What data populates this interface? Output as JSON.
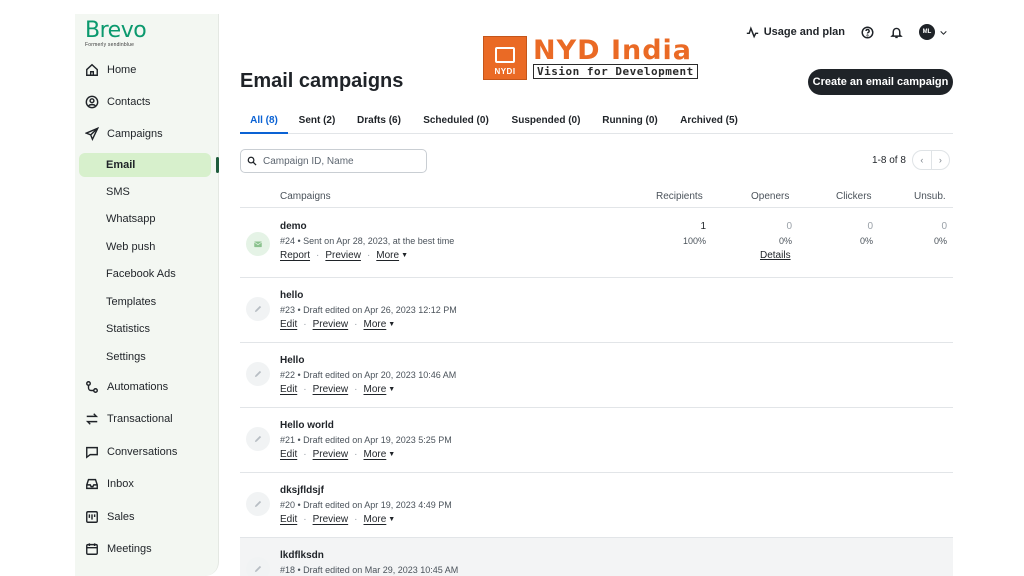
{
  "brand": {
    "name": "Brevo",
    "formerly": "Formerly sendinblue"
  },
  "watermark": {
    "badge": "NYDI",
    "title": "NYD India",
    "tagline": "Vision for Development"
  },
  "sidebar": {
    "items": [
      {
        "label": "Home",
        "icon": "home-icon"
      },
      {
        "label": "Contacts",
        "icon": "contacts-icon"
      },
      {
        "label": "Campaigns",
        "icon": "send-icon"
      }
    ],
    "campaign_subitems": [
      "Email",
      "SMS",
      "Whatsapp",
      "Web push",
      "Facebook Ads",
      "Templates",
      "Statistics",
      "Settings"
    ],
    "active_subitem": "Email",
    "lower_items": [
      {
        "label": "Automations",
        "icon": "automation-icon"
      },
      {
        "label": "Transactional",
        "icon": "transactional-icon"
      },
      {
        "label": "Conversations",
        "icon": "chat-icon"
      },
      {
        "label": "Inbox",
        "icon": "inbox-icon"
      },
      {
        "label": "Sales",
        "icon": "sales-icon"
      },
      {
        "label": "Meetings",
        "icon": "calendar-icon"
      }
    ]
  },
  "topbar": {
    "usage_label": "Usage and plan",
    "avatar_initials": "ML"
  },
  "page": {
    "title": "Email campaigns",
    "create_button": "Create an email campaign"
  },
  "tabs": [
    {
      "label": "All (8)",
      "active": true
    },
    {
      "label": "Sent (2)"
    },
    {
      "label": "Drafts (6)"
    },
    {
      "label": "Scheduled (0)"
    },
    {
      "label": "Suspended (0)"
    },
    {
      "label": "Running (0)"
    },
    {
      "label": "Archived (5)"
    }
  ],
  "search": {
    "placeholder": "Campaign ID, Name",
    "value": ""
  },
  "pagination": {
    "label": "1-8 of 8"
  },
  "table": {
    "headers": {
      "campaigns": "Campaigns",
      "recipients": "Recipients",
      "openers": "Openers",
      "clickers": "Clickers",
      "unsub": "Unsub."
    },
    "rows": [
      {
        "name": "demo",
        "meta": "#24 • Sent on Apr 28, 2023, at the best time",
        "status": "sent",
        "actions": [
          "Report",
          "Preview",
          "More"
        ],
        "recipients": "1",
        "recipients_pct": "100%",
        "openers": "0",
        "openers_pct": "0%",
        "clickers": "0",
        "clickers_pct": "0%",
        "unsub": "0",
        "unsub_pct": "0%",
        "details": "Details"
      },
      {
        "name": "hello",
        "meta": "#23 • Draft edited on Apr 26, 2023 12:12 PM",
        "status": "draft",
        "actions": [
          "Edit",
          "Preview",
          "More"
        ]
      },
      {
        "name": "Hello",
        "meta": "#22 • Draft edited on Apr 20, 2023 10:46 AM",
        "status": "draft",
        "actions": [
          "Edit",
          "Preview",
          "More"
        ]
      },
      {
        "name": "Hello world",
        "meta": "#21 • Draft edited on Apr 19, 2023 5:25 PM",
        "status": "draft",
        "actions": [
          "Edit",
          "Preview",
          "More"
        ]
      },
      {
        "name": "dksjfldsjf",
        "meta": "#20 • Draft edited on Apr 19, 2023 4:49 PM",
        "status": "draft",
        "actions": [
          "Edit",
          "Preview",
          "More"
        ]
      },
      {
        "name": "lkdflksdn",
        "meta": "#18 • Draft edited on Mar 29, 2023 10:45 AM",
        "status": "draft",
        "actions": []
      }
    ]
  },
  "colors": {
    "brand_green": "#0b996e",
    "active_bg": "#d7f0cc",
    "tab_blue": "#0a62d4",
    "watermark_orange": "#ea6a25"
  }
}
